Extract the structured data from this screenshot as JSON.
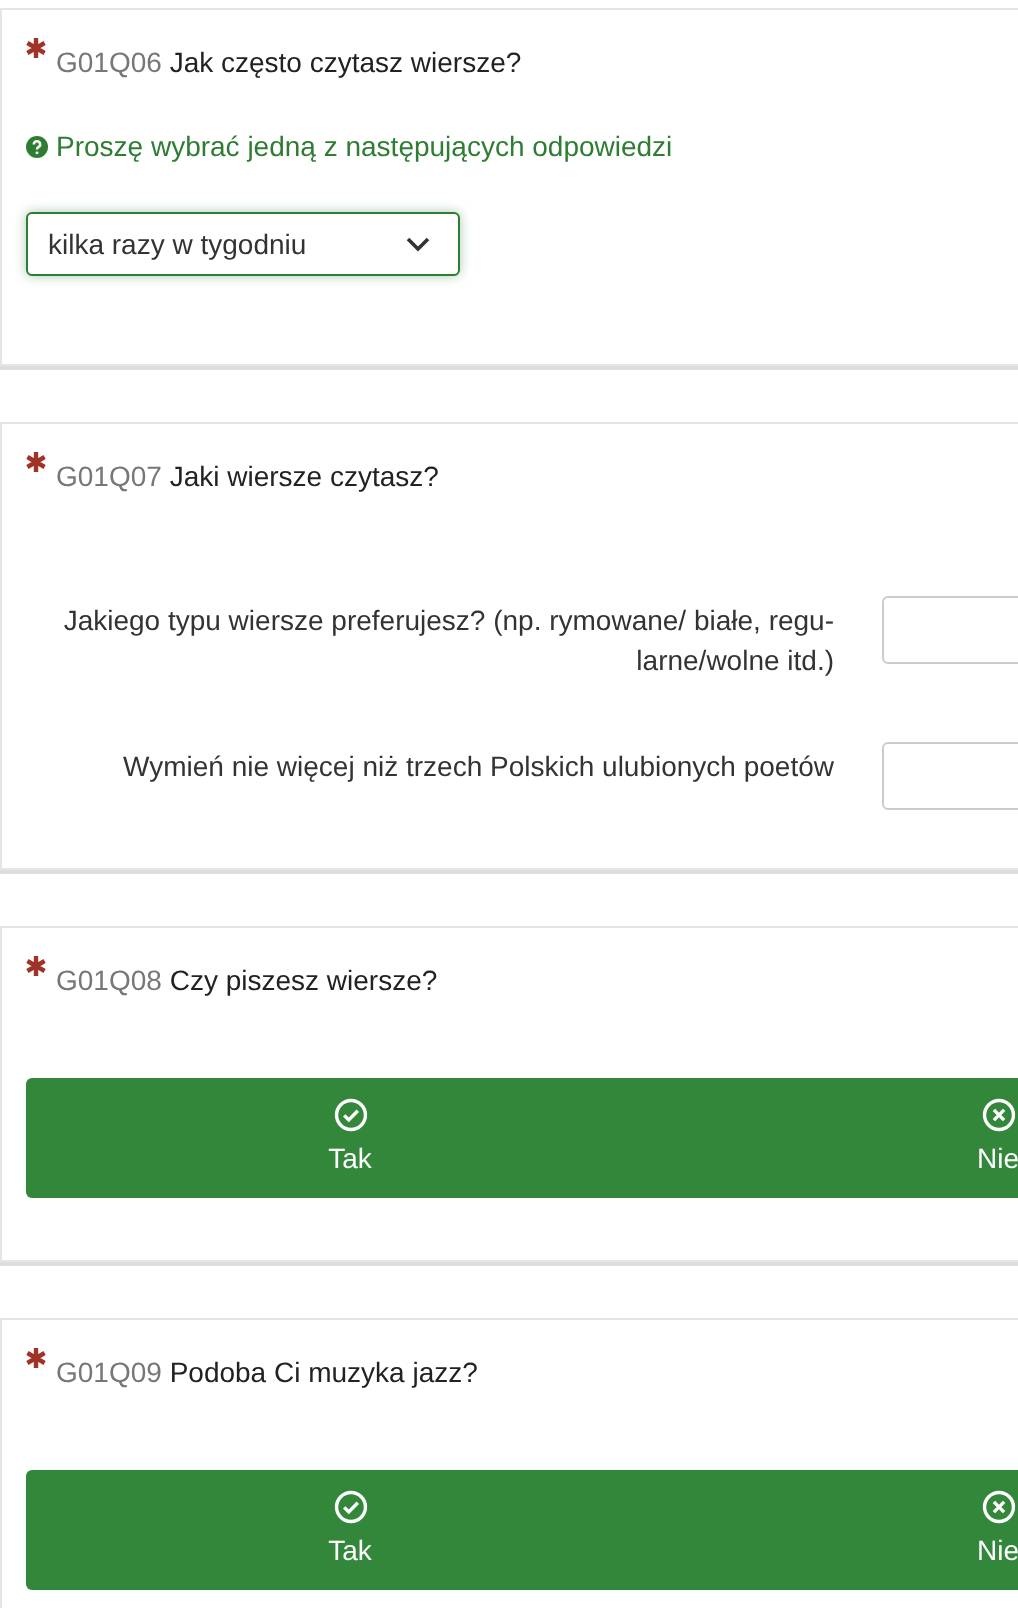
{
  "questions": [
    {
      "kind": "dropdown",
      "required": true,
      "code": "G01Q06",
      "text": "Jak często czytasz wiersze?",
      "help": "Proszę wybrać jedną z następujących odpowiedzi",
      "value": "kilka razy w tygodniu"
    },
    {
      "kind": "multi_text",
      "required": true,
      "code": "G01Q07",
      "text": "Jaki wiersze czytasz?",
      "items": [
        {
          "label": "Jakiego typu wiersze preferujesz? (np. rymowane/ białe, regu-larne/wolne itd.)"
        },
        {
          "label": "Wymień nie więcej niż trzech Polskich ulubionych poetów"
        }
      ]
    },
    {
      "kind": "yes_no",
      "required": true,
      "code": "G01Q08",
      "text": "Czy piszesz wiersze?",
      "options": [
        {
          "label": "Tak",
          "kind": "yes"
        },
        {
          "label": "Nie",
          "kind": "no"
        }
      ]
    },
    {
      "kind": "yes_no",
      "required": true,
      "code": "G01Q09",
      "text": "Podoba Ci muzyka jazz?",
      "options": [
        {
          "label": "Tak",
          "kind": "yes"
        },
        {
          "label": "Nie",
          "kind": "no"
        }
      ]
    }
  ]
}
